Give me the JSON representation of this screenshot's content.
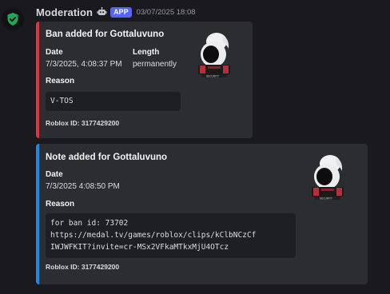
{
  "message": {
    "username": "Moderation",
    "badge": "APP",
    "timestamp": "03/07/2025 18:08",
    "avatar_icon": "shield-check-icon",
    "bot_icon": "robot-icon"
  },
  "embeds": [
    {
      "accent_color": "#da373c",
      "title": "Ban added for Gottaluvuno",
      "fields": [
        {
          "name": "Date",
          "value": "7/3/2025, 4:08:37 PM"
        },
        {
          "name": "Length",
          "value": "permanently"
        },
        {
          "name": "Reason",
          "code_lines": [
            "V-TOS"
          ]
        }
      ],
      "footer": "Roblox ID: 3177429200",
      "thumbnail_icon": "roblox-avatar-thumbnail"
    },
    {
      "accent_color": "#1e88e5",
      "title": "Note added for Gottaluvuno",
      "fields": [
        {
          "name": "Date",
          "value": "7/3/2025 4:08:50 PM"
        },
        {
          "name": "Reason",
          "code_lines": [
            "for ban id: 73702",
            "https://medal.tv/games/roblox/clips/kClbNCzCf",
            "IWJWFKIT?invite=cr-MSx2VFkaMTkxMjU4OTcz"
          ]
        }
      ],
      "footer": "Roblox ID: 3177429200",
      "thumbnail_icon": "roblox-avatar-thumbnail"
    }
  ]
}
